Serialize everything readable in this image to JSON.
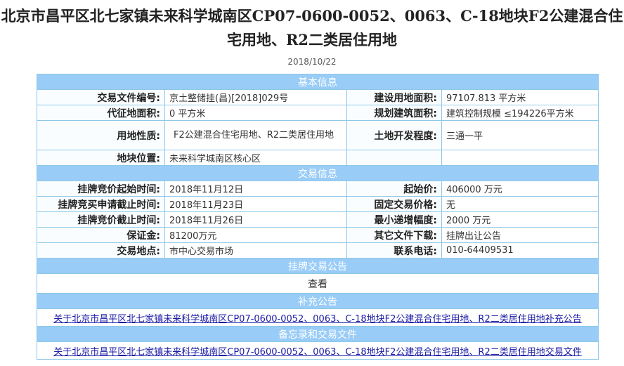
{
  "title": "北京市昌平区北七家镇未来科学城南区CP07-0600-0052、0063、C-18地块F2公建混合住宅用地、R2二类居住用地",
  "date": "2018/10/22",
  "basic": {
    "header": "基本信息",
    "rows": [
      [
        "交易文件编号:",
        "京土整储挂(昌)[2018]029号",
        "建设用地面积:",
        "97107.813 平方米"
      ],
      [
        "代征地面积:",
        "0 平方米",
        "规划建筑面积:",
        "建筑控制规模 ≤194226平方米"
      ],
      [
        "用地性质:",
        "F2公建混合住宅用地、R2二类居住用地",
        "土地开发程度:",
        "三通一平"
      ],
      [
        "地块位置:",
        "未来科学城南区核心区",
        "",
        ""
      ]
    ]
  },
  "trade": {
    "header": "交易信息",
    "rows": [
      [
        "挂牌竞价起始时间:",
        "2018年11月12日",
        "起始价:",
        "406000 万元"
      ],
      [
        "挂牌竞买申请截止时间:",
        "2018年11月23日",
        "固定交易价格:",
        "无"
      ],
      [
        "挂牌竞价截止时间:",
        "2018年11月26日",
        "最小递增幅度:",
        "2000 万元"
      ],
      [
        "保证金:",
        "81200万元",
        "其它文件下载:",
        "挂牌出让公告"
      ],
      [
        "交易地点:",
        "市中心交易市场",
        "联系电话:",
        "010-64409531"
      ]
    ]
  },
  "notice": {
    "header": "挂牌交易公告",
    "link": "查看"
  },
  "supplement": {
    "header": "补充公告",
    "link": "关于北京市昌平区北七家镇未来科学城南区CP07-0600-0052、0063、C-18地块F2公建混合住宅用地、R2二类居住用地补充公告"
  },
  "memo": {
    "header": "备忘录和交易文件",
    "link": "关于北京市昌平区北七家镇未来科学城南区CP07-0600-0052、0063、C-18地块F2公建混合住宅用地、R2二类居住用地交易文件"
  }
}
